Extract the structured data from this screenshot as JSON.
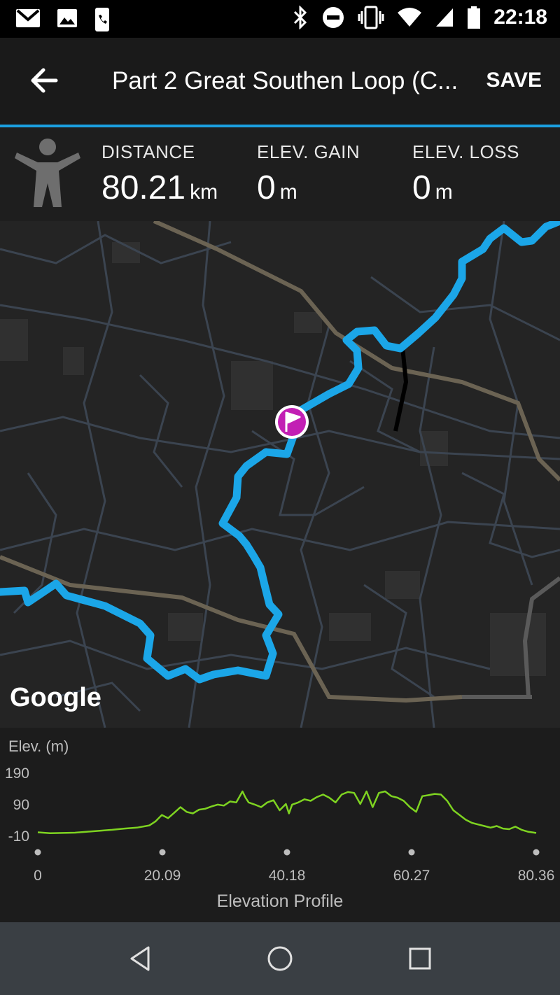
{
  "status_bar": {
    "time": "22:18",
    "icons": [
      "gmail-icon",
      "photo-icon",
      "phone-icon",
      "bluetooth-icon",
      "do-not-disturb-icon",
      "vibrate-icon",
      "wifi-icon",
      "signal-icon",
      "battery-icon"
    ]
  },
  "app_bar": {
    "title": "Part 2 Great Southen Loop (C...",
    "save_label": "SAVE"
  },
  "stats": {
    "distance": {
      "label": "DISTANCE",
      "value": "80.21",
      "unit": "km"
    },
    "elev_gain": {
      "label": "ELEV. GAIN",
      "value": "0",
      "unit": "m"
    },
    "elev_loss": {
      "label": "ELEV. LOSS",
      "value": "0",
      "unit": "m"
    }
  },
  "map": {
    "attribution": "Google",
    "route_color": "#1ba6e8",
    "start_marker_color": "#c21fb4"
  },
  "chart_data": {
    "type": "line",
    "title": "Elevation Profile",
    "ylabel": "Elev. (m)",
    "xlabel": "",
    "ylim": [
      -10,
      190
    ],
    "yticks": [
      "190",
      "90",
      "-10"
    ],
    "xticks": [
      "0",
      "20.09",
      "40.18",
      "60.27",
      "80.36"
    ],
    "xlim": [
      0,
      80.36
    ],
    "color": "#7ed321",
    "series": [
      {
        "x": [
          0,
          2,
          4,
          6,
          8,
          10,
          12,
          14,
          16,
          18,
          19,
          20,
          21,
          22,
          23,
          24,
          25,
          26,
          27,
          28,
          29,
          30,
          31,
          32,
          33,
          33.5,
          34,
          35,
          36,
          37,
          38,
          39,
          40,
          40.5,
          41,
          42,
          43,
          44,
          45,
          46,
          47,
          48,
          49,
          50,
          51,
          52,
          53,
          54,
          55,
          56,
          57,
          58,
          59,
          60,
          61,
          62,
          63,
          64,
          65,
          66,
          67,
          68,
          69,
          70,
          71,
          72,
          73,
          74,
          75,
          76,
          77,
          78,
          79,
          80.36
        ],
        "y": [
          0,
          -3,
          -2,
          -1,
          2,
          5,
          8,
          12,
          15,
          22,
          35,
          55,
          45,
          62,
          80,
          65,
          60,
          72,
          75,
          82,
          88,
          85,
          98,
          95,
          130,
          110,
          95,
          88,
          80,
          95,
          102,
          70,
          90,
          60,
          88,
          95,
          105,
          100,
          112,
          120,
          110,
          95,
          120,
          128,
          125,
          90,
          130,
          80,
          125,
          130,
          115,
          110,
          100,
          80,
          65,
          115,
          118,
          122,
          120,
          100,
          70,
          55,
          40,
          30,
          25,
          20,
          15,
          20,
          12,
          10,
          18,
          8,
          2,
          -2
        ]
      }
    ]
  }
}
